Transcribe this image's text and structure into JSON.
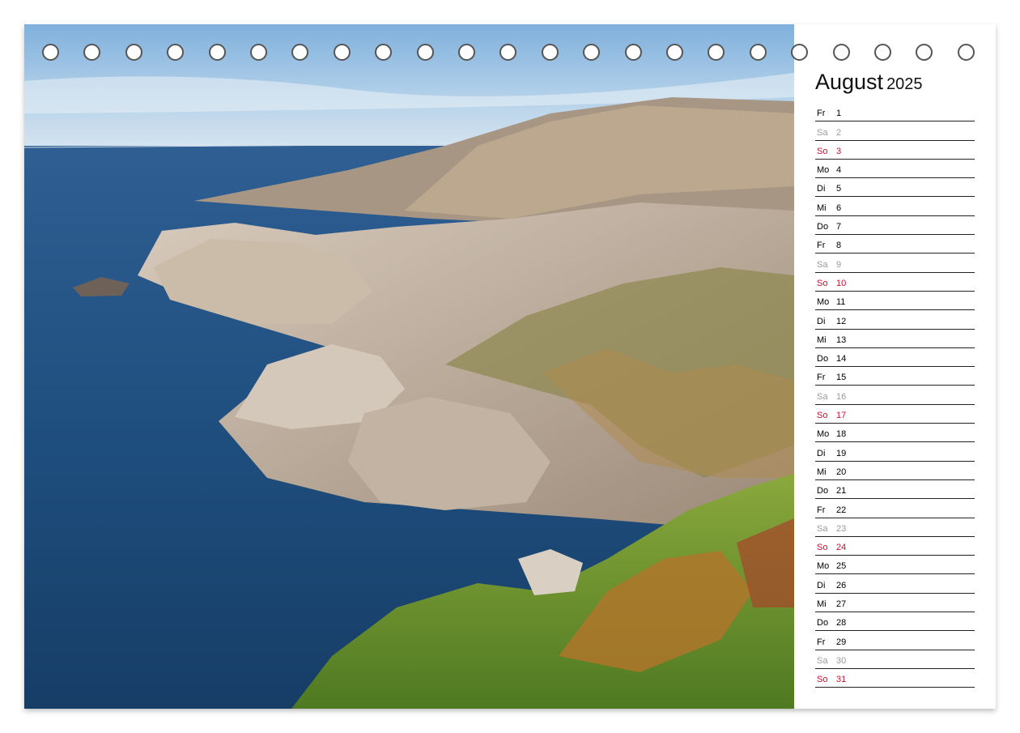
{
  "calendar": {
    "month": "August",
    "year": "2025",
    "days": [
      {
        "name": "Fr",
        "num": "1",
        "type": "weekday"
      },
      {
        "name": "Sa",
        "num": "2",
        "type": "sat"
      },
      {
        "name": "So",
        "num": "3",
        "type": "sun"
      },
      {
        "name": "Mo",
        "num": "4",
        "type": "weekday"
      },
      {
        "name": "Di",
        "num": "5",
        "type": "weekday"
      },
      {
        "name": "Mi",
        "num": "6",
        "type": "weekday"
      },
      {
        "name": "Do",
        "num": "7",
        "type": "weekday"
      },
      {
        "name": "Fr",
        "num": "8",
        "type": "weekday"
      },
      {
        "name": "Sa",
        "num": "9",
        "type": "sat"
      },
      {
        "name": "So",
        "num": "10",
        "type": "sun"
      },
      {
        "name": "Mo",
        "num": "11",
        "type": "weekday"
      },
      {
        "name": "Di",
        "num": "12",
        "type": "weekday"
      },
      {
        "name": "Mi",
        "num": "13",
        "type": "weekday"
      },
      {
        "name": "Do",
        "num": "14",
        "type": "weekday"
      },
      {
        "name": "Fr",
        "num": "15",
        "type": "weekday"
      },
      {
        "name": "Sa",
        "num": "16",
        "type": "sat"
      },
      {
        "name": "So",
        "num": "17",
        "type": "sun"
      },
      {
        "name": "Mo",
        "num": "18",
        "type": "weekday"
      },
      {
        "name": "Di",
        "num": "19",
        "type": "weekday"
      },
      {
        "name": "Mi",
        "num": "20",
        "type": "weekday"
      },
      {
        "name": "Do",
        "num": "21",
        "type": "weekday"
      },
      {
        "name": "Fr",
        "num": "22",
        "type": "weekday"
      },
      {
        "name": "Sa",
        "num": "23",
        "type": "sat"
      },
      {
        "name": "So",
        "num": "24",
        "type": "sun"
      },
      {
        "name": "Mo",
        "num": "25",
        "type": "weekday"
      },
      {
        "name": "Di",
        "num": "26",
        "type": "weekday"
      },
      {
        "name": "Mi",
        "num": "27",
        "type": "weekday"
      },
      {
        "name": "Do",
        "num": "28",
        "type": "weekday"
      },
      {
        "name": "Fr",
        "num": "29",
        "type": "weekday"
      },
      {
        "name": "Sa",
        "num": "30",
        "type": "sat"
      },
      {
        "name": "So",
        "num": "31",
        "type": "sun"
      }
    ]
  },
  "colors": {
    "sunday": "#c8102e",
    "saturday": "#9a9a9a",
    "text": "#111111",
    "sea": "#1f4f7f",
    "sky": "#9fc3e2"
  },
  "binding": {
    "ring_count": 23
  }
}
